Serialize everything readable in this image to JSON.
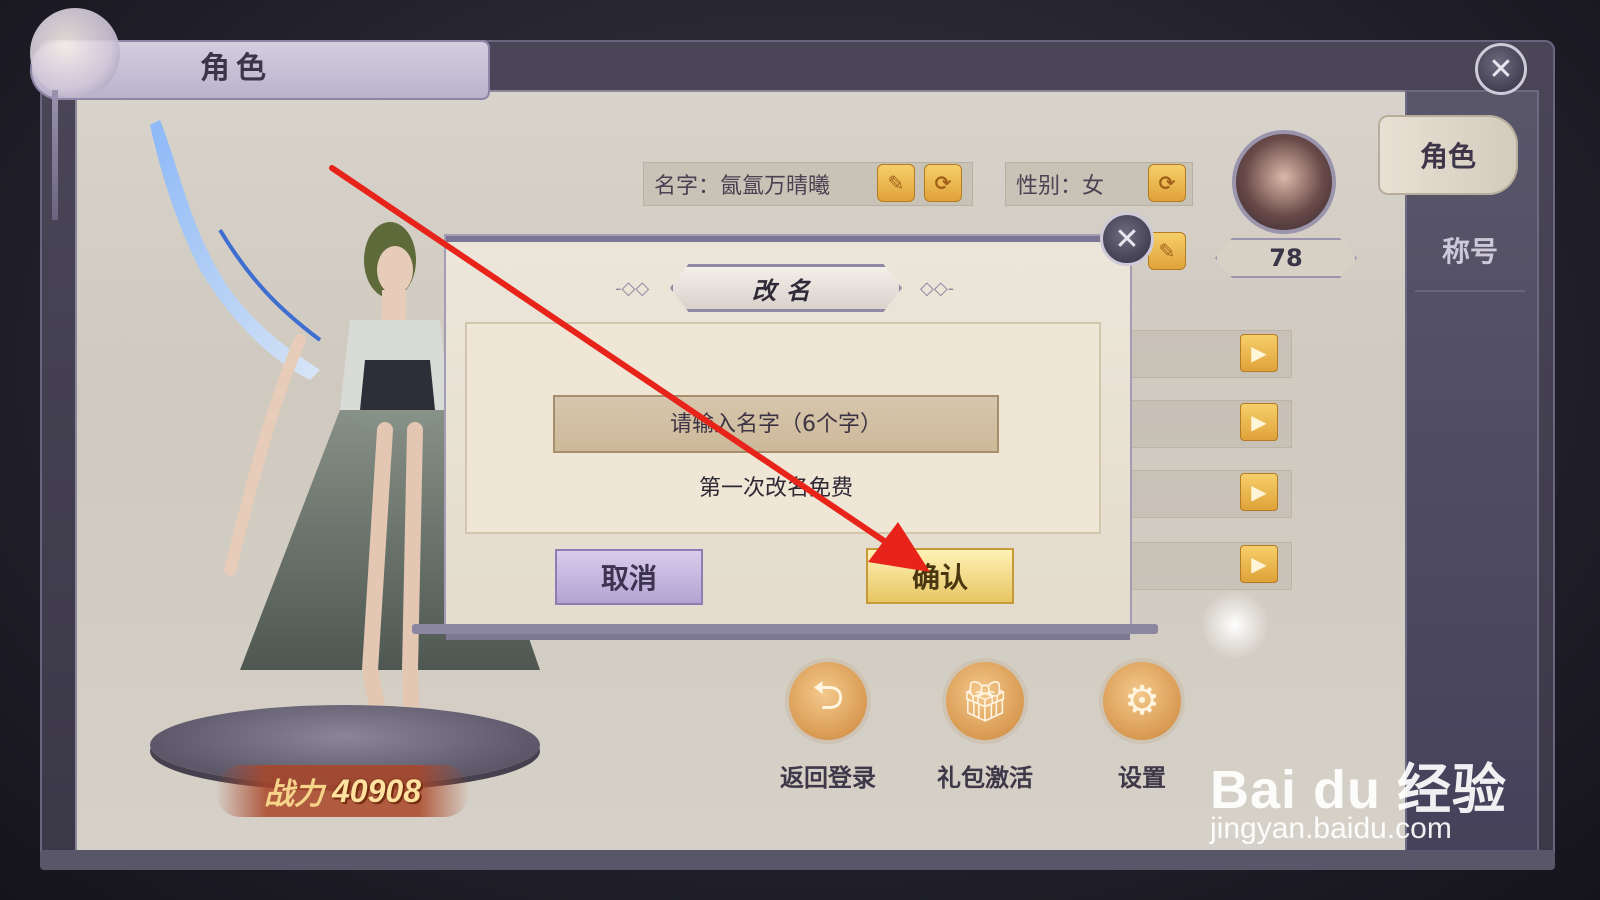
{
  "header": {
    "title": "角色"
  },
  "tabs": [
    {
      "label": "角色",
      "active": true
    },
    {
      "label": "称号",
      "active": false
    }
  ],
  "character": {
    "name_field": "名字：氤氲万晴曦",
    "gender_field": "性别：女",
    "level": "78",
    "power_label": "战力",
    "power_value": "40908"
  },
  "actions": [
    {
      "label": "返回登录",
      "icon": "logout-arrow-icon"
    },
    {
      "label": "礼包激活",
      "icon": "gift-icon"
    },
    {
      "label": "设置",
      "icon": "gear-icon"
    }
  ],
  "dialog": {
    "title": "改名",
    "input_placeholder": "请输入名字（6个字）",
    "note": "第一次改名免费",
    "cancel_label": "取消",
    "confirm_label": "确认"
  },
  "icons": {
    "close": "close-icon",
    "edit": "edit-note-icon",
    "refresh": "refresh-icon",
    "play": "play-arrow-icon"
  },
  "colors": {
    "accent_gold": "#e0a23a",
    "dialog_purple": "#7b7596",
    "annotation_red": "#e8231a"
  },
  "watermark": {
    "logo": "Bai du 经验",
    "url": "jingyan.baidu.com"
  }
}
